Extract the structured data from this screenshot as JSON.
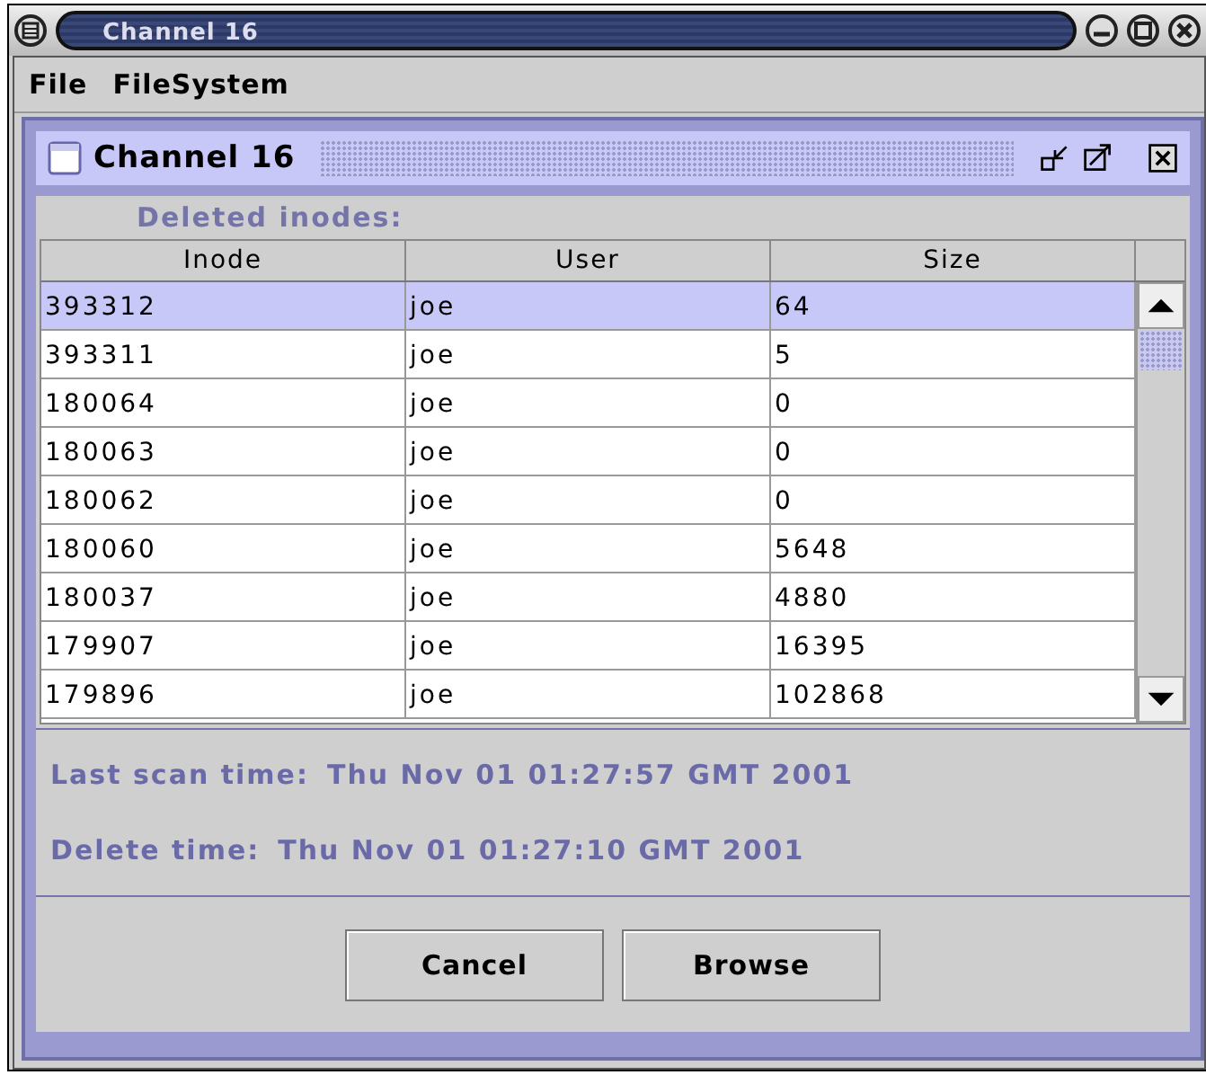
{
  "window": {
    "title": "Channel 16"
  },
  "menu": [
    "File",
    "FileSystem"
  ],
  "internal_frame": {
    "title": "Channel 16"
  },
  "section_label": "Deleted inodes:",
  "table": {
    "columns": [
      "Inode",
      "User",
      "Size"
    ],
    "rows": [
      {
        "cells": [
          "393312",
          "joe",
          "64"
        ],
        "selected": true
      },
      {
        "cells": [
          "393311",
          "joe",
          "5"
        ],
        "selected": false
      },
      {
        "cells": [
          "180064",
          "joe",
          "0"
        ],
        "selected": false
      },
      {
        "cells": [
          "180063",
          "joe",
          "0"
        ],
        "selected": false
      },
      {
        "cells": [
          "180062",
          "joe",
          "0"
        ],
        "selected": false
      },
      {
        "cells": [
          "180060",
          "joe",
          "5648"
        ],
        "selected": false
      },
      {
        "cells": [
          "180037",
          "joe",
          "4880"
        ],
        "selected": false
      },
      {
        "cells": [
          "179907",
          "joe",
          "16395"
        ],
        "selected": false
      },
      {
        "cells": [
          "179896",
          "joe",
          "102868"
        ],
        "selected": false
      }
    ]
  },
  "scan_info": [
    {
      "label": "Last scan time:",
      "value": "Thu Nov 01 01:27:57 GMT 2001"
    },
    {
      "label": "Delete time:",
      "value": "Thu Nov 01 01:27:10 GMT 2001"
    }
  ],
  "buttons": [
    "Cancel",
    "Browse"
  ]
}
